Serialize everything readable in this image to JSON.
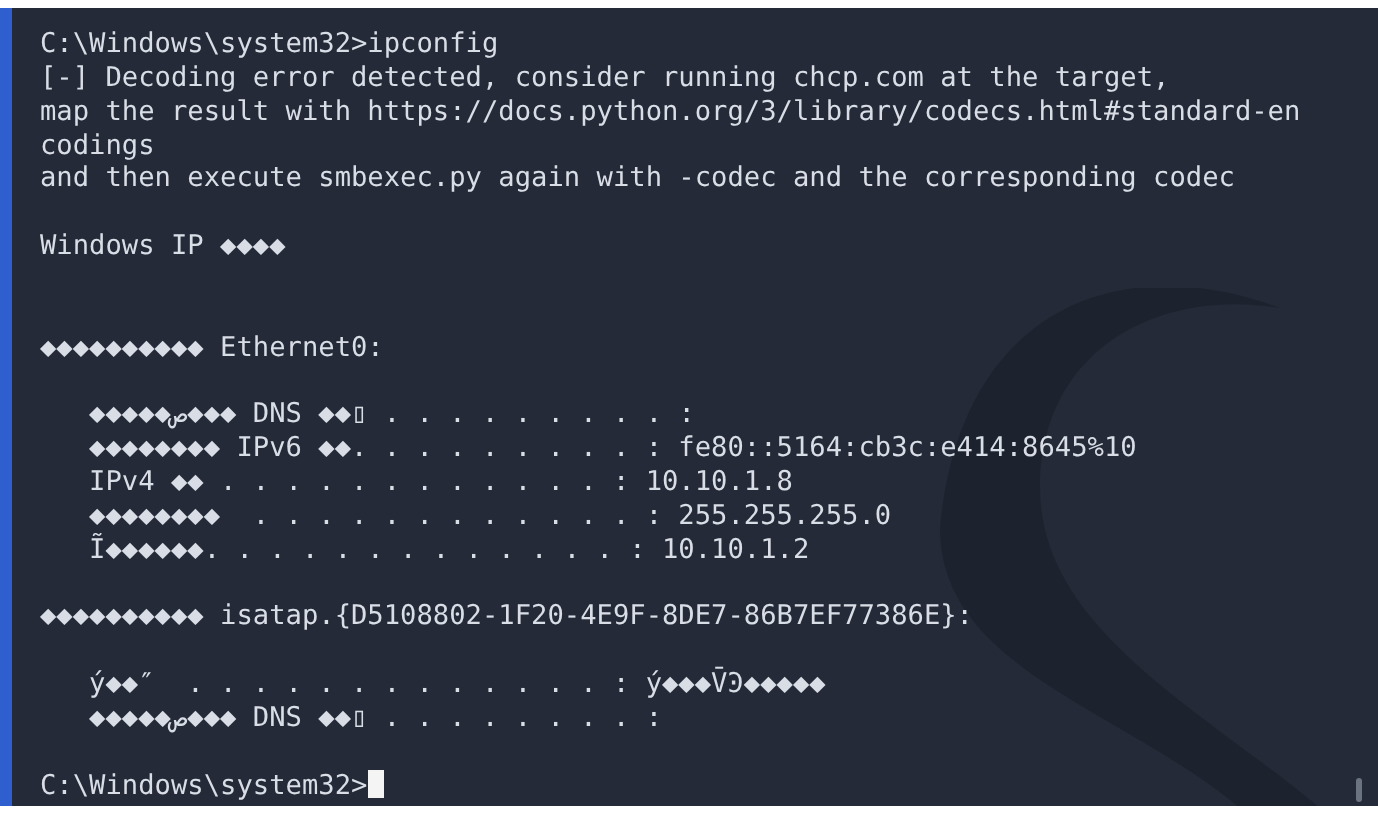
{
  "terminal": {
    "lines": [
      {
        "kind": "text",
        "text": "C:\\Windows\\system32>ipconfig"
      },
      {
        "kind": "text",
        "text": "[-] Decoding error detected, consider running chcp.com at the target,"
      },
      {
        "kind": "text",
        "text": "map the result with https://docs.python.org/3/library/codecs.html#standard-en"
      },
      {
        "kind": "text",
        "text": "codings"
      },
      {
        "kind": "text",
        "text": "and then execute smbexec.py again with -codec and the corresponding codec"
      },
      {
        "kind": "blank"
      },
      {
        "kind": "text",
        "text": "Windows IP ◆◆◆◆"
      },
      {
        "kind": "blank"
      },
      {
        "kind": "blank"
      },
      {
        "kind": "text",
        "text": "◆◆◆◆◆◆◆◆◆◆ Ethernet0:"
      },
      {
        "kind": "blank"
      },
      {
        "kind": "text",
        "text": "   ◆◆◆◆◆ص◆◆◆ DNS ◆◆▯ . . . . . . . . . :"
      },
      {
        "kind": "text",
        "text": "   ◆◆◆◆◆◆◆◆ IPv6 ◆◆. . . . . . . . . : fe80::5164:cb3c:e414:8645%10"
      },
      {
        "kind": "text",
        "text": "   IPv4 ◆◆ . . . . . . . . . . . . : 10.10.1.8"
      },
      {
        "kind": "text",
        "text": "   ◆◆◆◆◆◆◆◆  . . . . . . . . . . . . : 255.255.255.0"
      },
      {
        "kind": "text",
        "text": "   Ĩ◆◆◆◆◆◆. . . . . . . . . . . . . : 10.10.1.2"
      },
      {
        "kind": "blank"
      },
      {
        "kind": "text",
        "text": "◆◆◆◆◆◆◆◆◆◆ isatap.{D5108802-1F20-4E9F-8DE7-86B7EF77386E}:"
      },
      {
        "kind": "blank"
      },
      {
        "kind": "text",
        "text": "   ý◆◆″  . . . . . . . . . . . . . : ý◆◆◆V̄Ͽ◆◆◆◆◆"
      },
      {
        "kind": "text",
        "text": "   ◆◆◆◆◆ص◆◆◆ DNS ◆◆▯ . . . . . . . . :"
      },
      {
        "kind": "blank"
      },
      {
        "kind": "prompt",
        "text": "C:\\Windows\\system32>"
      }
    ]
  }
}
